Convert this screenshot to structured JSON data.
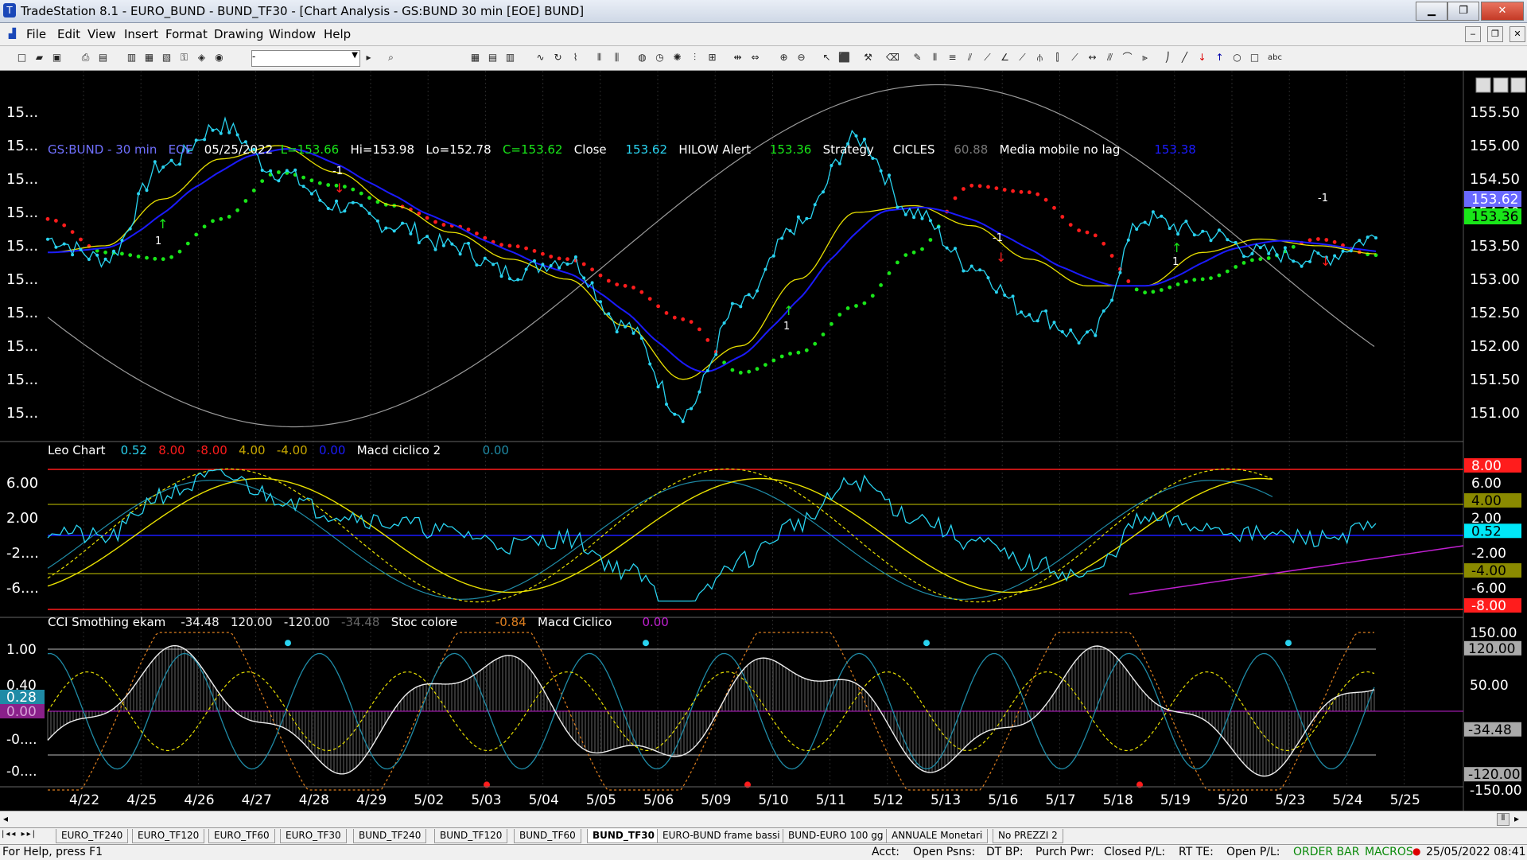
{
  "window": {
    "title": "TradeStation 8.1 - EURO_BUND - BUND_TF30 - [Chart Analysis - GS:BUND  30 min  [EOE] BUND]"
  },
  "menu": [
    "File",
    "Edit",
    "View",
    "Insert",
    "Format",
    "Drawing",
    "Window",
    "Help"
  ],
  "toolbar": {
    "combo_value": "-"
  },
  "infobar": {
    "symbol": "GS:BUND - 30 min",
    "session": "EOE",
    "date": "05/25/2022",
    "last": "L=153.66",
    "high": "Hi=153.98",
    "low": "Lo=152.78",
    "close_val": "C=153.62",
    "close_label": "Close",
    "close_num": "153.62",
    "hilow_label": "HILOW Alert",
    "hilow_num": "153.36",
    "strategy_label": "Strategy",
    "cicles_label": "CICLES",
    "cicles_num": "60.88",
    "media_label": "Media mobile no lag",
    "media_num": "153.38"
  },
  "panel2": {
    "name": "Leo Chart",
    "v1": "0.52",
    "v2": "8.00",
    "v3": "-8.00",
    "v4": "4.00",
    "v5": "-4.00",
    "v6": "0.00",
    "name2": "Macd ciclico 2",
    "v7": "0.00"
  },
  "panel3": {
    "name": "CCI Smothing ekam",
    "v1": "-34.48",
    "v2": "120.00",
    "v3": "-120.00",
    "v4": "-34.48",
    "name2": "Stoc colore",
    "v5": "-0.84",
    "name3": "Macd Ciclico",
    "v6": "0.00"
  },
  "price_axis": [
    "155.50",
    "155.00",
    "154.50",
    "154.00",
    "153.50",
    "153.00",
    "152.50",
    "152.00",
    "151.50",
    "151.00"
  ],
  "price_left_labels": [
    "15...",
    "15...",
    "15...",
    "15...",
    "15...",
    "15...",
    "15...",
    "15...",
    "15...",
    "15..."
  ],
  "price_tags": {
    "blue": "153.62",
    "green": "153.36"
  },
  "ind_axis": [
    "8.00",
    "6.00",
    "4.00",
    "2.00",
    "0.52",
    "-2.00",
    "-4.00",
    "-6.00",
    "-8.00"
  ],
  "ind_left_labels": [
    "6.00",
    "2.00",
    "-2....",
    "-6...."
  ],
  "cci_axis": [
    "150.00",
    "120.00",
    "50.00",
    "-34.48",
    "-120.00",
    "-150.00"
  ],
  "cci_left_labels": [
    "1.00",
    "0.40",
    "0.28",
    "0.00",
    "-0....",
    "-0...."
  ],
  "dates": [
    "4/22",
    "4/25",
    "4/26",
    "4/27",
    "4/28",
    "4/29",
    "5/02",
    "5/03",
    "5/04",
    "5/05",
    "5/06",
    "5/09",
    "5/10",
    "5/11",
    "5/12",
    "5/13",
    "5/16",
    "5/17",
    "5/18",
    "5/19",
    "5/20",
    "5/23",
    "5/24",
    "5/25"
  ],
  "chart_data": {
    "type": "line",
    "title": "GS:BUND - 30 min",
    "series": [
      {
        "name": "Close",
        "values": [
          153.6,
          153.3,
          154.7,
          155.3,
          154.6,
          154.1,
          153.8,
          153.5,
          153.1,
          153.3,
          152.3,
          151.0,
          152.6,
          153.8,
          155.1,
          154.0,
          153.2,
          152.5,
          152.1,
          153.9,
          153.7,
          153.4,
          153.3,
          153.62
        ]
      },
      {
        "name": "Media mobile no lag",
        "values": [
          153.4,
          153.5,
          154.2,
          154.8,
          155.0,
          154.6,
          154.1,
          153.7,
          153.3,
          153.0,
          152.3,
          151.5,
          152.0,
          153.0,
          154.0,
          154.1,
          153.8,
          153.3,
          152.9,
          152.9,
          153.4,
          153.6,
          153.5,
          153.38
        ]
      },
      {
        "name": "HILOW Alert",
        "values": [
          153.9,
          153.4,
          153.3,
          153.9,
          154.6,
          154.4,
          154.1,
          153.8,
          153.5,
          153.3,
          152.9,
          152.4,
          151.6,
          151.9,
          152.6,
          153.4,
          154.4,
          154.3,
          153.7,
          152.8,
          153.0,
          153.3,
          153.6,
          153.36
        ]
      }
    ],
    "xlabel": "",
    "ylabel": "",
    "ylim": [
      150.7,
      156.0
    ]
  },
  "tabs": [
    "EURO_TF240",
    "EURO_TF120",
    "EURO_TF60",
    "EURO_TF30",
    "BUND_TF240",
    "BUND_TF120",
    "BUND_TF60",
    "BUND_TF30",
    "EURO-BUND frame bassi",
    "BUND-EURO 100 gg",
    "ANNUALE Monetari",
    "No PREZZI 2"
  ],
  "status": {
    "help": "For Help, press F1",
    "acct": "Acct:",
    "open_psns": "Open Psns:",
    "dt_bp": "DT BP:",
    "purch": "Purch Pwr:",
    "closed_pl": "Closed P/L:",
    "rt_te": "RT TE:",
    "open_pl": "Open P/L:",
    "order_bar": "ORDER BAR",
    "macros": "MACROS",
    "datetime": "25/05/2022 08:41"
  },
  "colors": {
    "price_line": "#29d3f0",
    "ma_blue": "#1b1bff",
    "ma_yellow": "#e8e000",
    "hilow_red": "#ff1c1c",
    "hilow_green": "#19e619",
    "cycle": "#9a9a9a"
  }
}
